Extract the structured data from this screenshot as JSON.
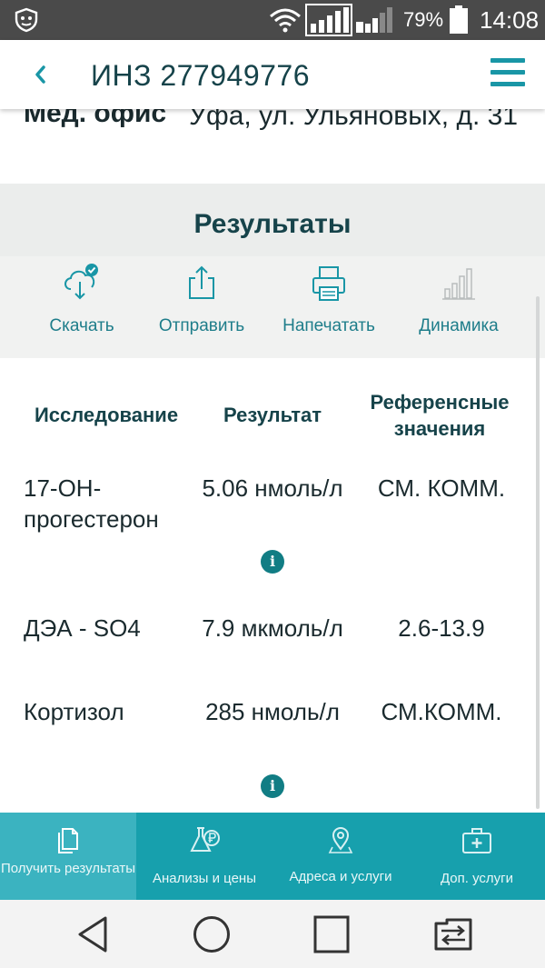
{
  "status_bar": {
    "battery_percent": "79%",
    "time": "14:08",
    "icons": [
      "antivirus-icon",
      "wifi-icon",
      "signal-sim1-icon",
      "signal-sim2-icon",
      "battery-icon"
    ]
  },
  "header": {
    "title": "ИНЗ 277949776",
    "back_icon": "chevron-left-icon",
    "menu_icon": "hamburger-menu-icon"
  },
  "office": {
    "label": "Мед. офис",
    "value": "Уфа, ул. Ульяновых, д. 31"
  },
  "results": {
    "title": "Результаты",
    "actions": [
      {
        "label": "Скачать",
        "icon": "cloud-download-icon"
      },
      {
        "label": "Отправить",
        "icon": "share-icon"
      },
      {
        "label": "Напечатать",
        "icon": "printer-icon"
      },
      {
        "label": "Динамика",
        "icon": "bar-chart-icon"
      }
    ],
    "columns": {
      "study": "Исследование",
      "result": "Результат",
      "reference": "Референсные значения"
    },
    "rows": [
      {
        "study": "17-ОН-прогестерон",
        "result": "5.06 нмоль/л",
        "reference": "СМ. КОММ.",
        "info": true
      },
      {
        "study": "ДЭА - SO4",
        "result": "7.9 мкмоль/л",
        "reference": "2.6-13.9",
        "info": false
      },
      {
        "study": "Кортизол",
        "result": "285 нмоль/л",
        "reference": "СМ.КОММ.",
        "info": true
      }
    ],
    "info_glyph": "i"
  },
  "bottom_nav": {
    "tabs": [
      {
        "label": "Получить результаты",
        "icon": "document-icon",
        "active": true
      },
      {
        "label": "Анализы и цены",
        "icon": "flask-ruble-icon",
        "active": false
      },
      {
        "label": "Адреса и услуги",
        "icon": "map-pin-icon",
        "active": false
      },
      {
        "label": "Доп. услуги",
        "icon": "medical-kit-icon",
        "active": false
      }
    ]
  },
  "system_nav": {
    "icons": [
      "back-triangle-icon",
      "home-circle-icon",
      "recents-square-icon",
      "switch-sim-icon"
    ]
  },
  "colors": {
    "accent": "#1996a6",
    "title_text": "#16434a",
    "nav_bg": "#17a0ad",
    "nav_active": "#3bb3c0",
    "info_badge": "#117d84"
  }
}
